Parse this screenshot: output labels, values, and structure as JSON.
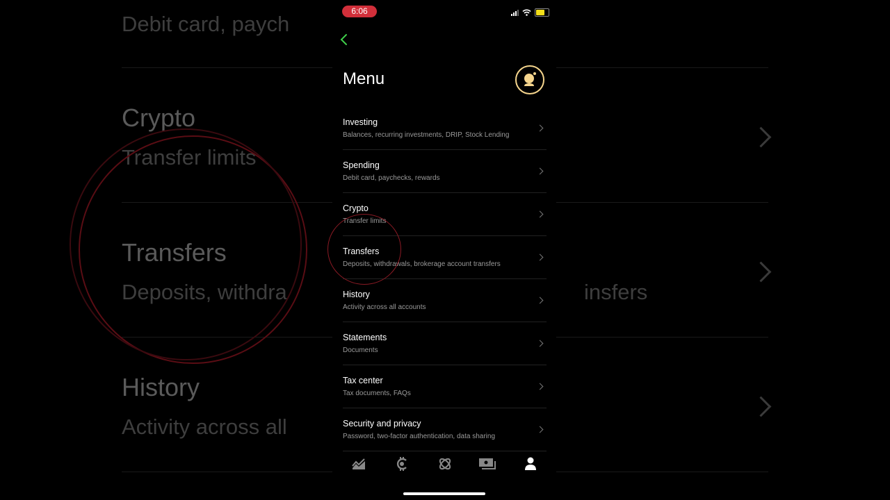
{
  "background": {
    "rows": [
      {
        "title": "",
        "subtitle": "Debit card, paych"
      },
      {
        "title": "Crypto",
        "subtitle": "Transfer limits"
      },
      {
        "title": "Transfers",
        "subtitle": "Deposits, withdra",
        "right_subtitle": "insfers"
      },
      {
        "title": "History",
        "subtitle": "Activity across all"
      }
    ]
  },
  "status_bar": {
    "time": "6:06",
    "time_badge_color": "#d12f3a",
    "battery_color": "#f2de1a"
  },
  "header": {
    "back_icon": "chevron-left-icon",
    "back_color": "#3fcf4a",
    "title": "Menu",
    "avatar_color": "#f5d58d"
  },
  "menu": {
    "items": [
      {
        "title": "Investing",
        "subtitle": "Balances, recurring investments, DRIP, Stock Lending"
      },
      {
        "title": "Spending",
        "subtitle": "Debit card, paychecks, rewards"
      },
      {
        "title": "Crypto",
        "subtitle": "Transfer limits"
      },
      {
        "title": "Transfers",
        "subtitle": "Deposits, withdrawals, brokerage account transfers"
      },
      {
        "title": "History",
        "subtitle": "Activity across all accounts"
      },
      {
        "title": "Statements",
        "subtitle": "Documents"
      },
      {
        "title": "Tax center",
        "subtitle": "Tax documents, FAQs"
      },
      {
        "title": "Security and privacy",
        "subtitle": "Password, two-factor authentication, data sharing"
      }
    ]
  },
  "bottom_nav": {
    "items": [
      {
        "icon": "chart-icon",
        "active": false
      },
      {
        "icon": "crypto-icon",
        "active": false
      },
      {
        "icon": "orbit-icon",
        "active": false
      },
      {
        "icon": "cash-icon",
        "active": false
      },
      {
        "icon": "person-icon",
        "active": true
      }
    ]
  },
  "annotation": {
    "highlighted_item": "Transfers",
    "color": "#8a1a24"
  }
}
